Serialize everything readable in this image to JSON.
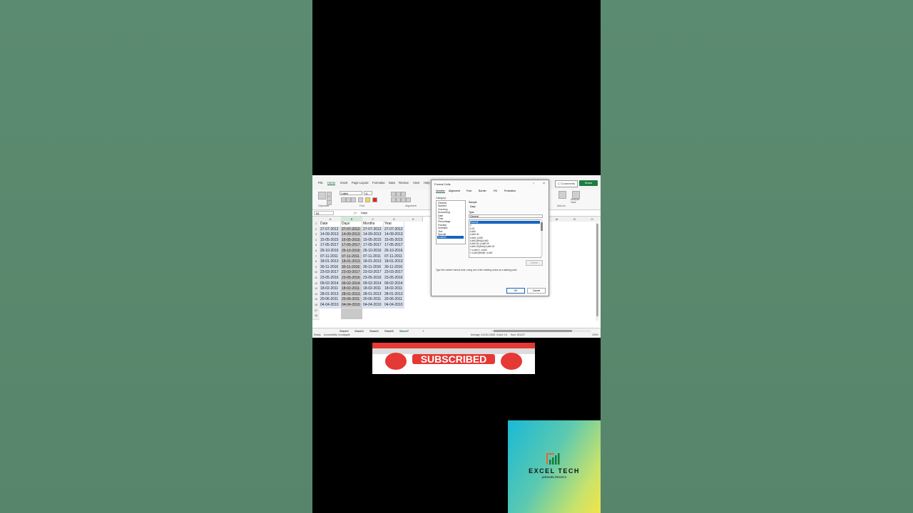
{
  "ribbon_tabs": [
    "File",
    "Home",
    "Insert",
    "Page Layout",
    "Formulas",
    "Data",
    "Review",
    "View",
    "Help"
  ],
  "active_tab": "Home",
  "comments_label": "Comments",
  "share_label": "Share",
  "ribbon_groups": {
    "clipboard": "Clipboard",
    "font": "Font",
    "alignment": "Alignment",
    "addins": "Add-ins",
    "analyze": "Analyze Data",
    "font_name": "Calibri",
    "font_size": "11"
  },
  "name_box": "B1",
  "formula_value": "Days",
  "columns": [
    "A",
    "B",
    "C",
    "D",
    "E",
    "F",
    "G",
    "H",
    "I",
    "J",
    "K",
    "L",
    "M",
    "N",
    "O"
  ],
  "header_row": [
    "Date",
    "Days",
    "Months",
    "Year"
  ],
  "rows": [
    [
      "27-07-2012",
      "27-07-2012",
      "27-07-2012",
      "27-07-2012"
    ],
    [
      "14-09-2013",
      "14-09-2013",
      "14-09-2013",
      "14-09-2013"
    ],
    [
      "15-05-2015",
      "15-05-2015",
      "15-05-2015",
      "15-05-2015"
    ],
    [
      "17-05-2017",
      "17-05-2017",
      "17-05-2017",
      "17-05-2017"
    ],
    [
      "26-10-2016",
      "26-10-2016",
      "26-10-2016",
      "26-10-2016"
    ],
    [
      "07-11-2011",
      "07-11-2011",
      "07-11-2011",
      "07-11-2011"
    ],
    [
      "18-01-2013",
      "18-01-2013",
      "18-01-2013",
      "18-01-2013"
    ],
    [
      "30-11-2016",
      "30-11-2016",
      "30-11-2016",
      "30-11-2016"
    ],
    [
      "23-03-2017",
      "23-03-2017",
      "23-03-2017",
      "23-03-2017"
    ],
    [
      "23-05-2016",
      "23-05-2016",
      "23-05-2016",
      "23-05-2016"
    ],
    [
      "09-02-2014",
      "09-02-2014",
      "09-02-2014",
      "09-02-2014"
    ],
    [
      "18-02-2011",
      "18-02-2011",
      "18-02-2011",
      "18-02-2011"
    ],
    [
      "28-01-2013",
      "28-01-2013",
      "28-01-2013",
      "28-01-2013"
    ],
    [
      "20-06-2011",
      "20-06-2011",
      "20-06-2011",
      "20-06-2011"
    ],
    [
      "04-04-2010",
      "04-04-2010",
      "04-04-2010",
      "04-04-2010"
    ]
  ],
  "sheet_tabs": [
    "Sheet2",
    "Sheet3",
    "Sheet4",
    "Sheet5",
    "Sheet7"
  ],
  "active_sheet": "Sheet7",
  "status": {
    "ready": "Ready",
    "accessibility": "Accessibility: Investigate",
    "average": "Average: 41415.13333",
    "count": "Count: 16",
    "sum": "Sum: 621227",
    "zoom": "100%"
  },
  "dialog": {
    "title": "Format Cells",
    "tabs": [
      "Number",
      "Alignment",
      "Font",
      "Border",
      "Fill",
      "Protection"
    ],
    "active_tab": "Number",
    "category_label": "Category:",
    "categories": [
      "General",
      "Number",
      "Currency",
      "Accounting",
      "Date",
      "Time",
      "Percentage",
      "Fraction",
      "Scientific",
      "Text",
      "Special",
      "Custom"
    ],
    "selected_category": "Custom",
    "sample_label": "Sample",
    "sample_value": "Days",
    "type_label": "Type:",
    "type_value": "General",
    "formats": [
      "General",
      "0",
      "0.00",
      "#,##0",
      "#,##0.00",
      "#,##0;-#,##0",
      "#,##0;[Red]-#,##0",
      "#,##0.00;-#,##0.00",
      "#,##0.00;[Red]-#,##0.00",
      "₹ #,##0;₹ -#,##0",
      "₹ #,##0;[Red]₹ -#,##0"
    ],
    "selected_format": "General",
    "delete_label": "Delete",
    "hint": "Type the number format code, using one of the existing codes as a starting point.",
    "ok_label": "OK",
    "cancel_label": "Cancel"
  },
  "subscribe_label": "SUBSCRIBED",
  "logo": {
    "name": "EXCEL TECH",
    "handle": "@EXCELTECH72"
  },
  "colors": {
    "excel_green": "#1e7c41",
    "selection_blue": "#1565c0",
    "subscribe_red": "#e53935"
  }
}
